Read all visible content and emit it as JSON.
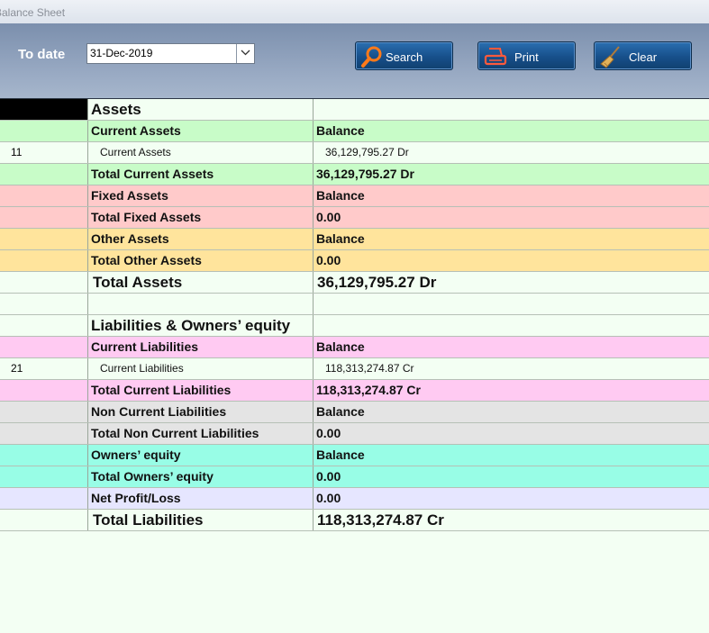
{
  "window": {
    "title": "Balance Sheet"
  },
  "toolbar": {
    "to_date_label": "To date",
    "date_value": "31-Dec-2019",
    "search_label": "Search",
    "print_label": "Print",
    "clear_label": "Clear"
  },
  "colors": {
    "green": "#c8fcc8",
    "red": "#ffcaca",
    "orange": "#ffe49c",
    "pink": "#ffcaf2",
    "gray": "#e4e4e4",
    "aqua": "#98fde6",
    "lavender": "#e6e6ff",
    "base": "#f3fff3"
  },
  "rows": [
    {
      "code": "",
      "name": "Assets",
      "value": ""
    },
    {
      "code": "",
      "name": "Current Assets",
      "value": "Balance"
    },
    {
      "code": "11",
      "name": "Current Assets",
      "value": "36,129,795.27 Dr"
    },
    {
      "code": "",
      "name": "Total Current Assets",
      "value": "36,129,795.27 Dr"
    },
    {
      "code": "",
      "name": "Fixed Assets",
      "value": "Balance"
    },
    {
      "code": "",
      "name": "Total Fixed Assets",
      "value": "0.00"
    },
    {
      "code": "",
      "name": "Other Assets",
      "value": "Balance"
    },
    {
      "code": "",
      "name": "Total Other Assets",
      "value": "0.00"
    },
    {
      "code": "",
      "name": "Total Assets",
      "value": "36,129,795.27 Dr"
    },
    {
      "code": "",
      "name": "",
      "value": ""
    },
    {
      "code": "",
      "name": "Liabilities & Owners’ equity",
      "value": ""
    },
    {
      "code": "",
      "name": "Current Liabilities",
      "value": "Balance"
    },
    {
      "code": "21",
      "name": "Current Liabilities",
      "value": "118,313,274.87 Cr"
    },
    {
      "code": "",
      "name": "Total Current Liabilities",
      "value": "118,313,274.87 Cr"
    },
    {
      "code": "",
      "name": "Non Current Liabilities",
      "value": "Balance"
    },
    {
      "code": "",
      "name": "Total Non Current Liabilities",
      "value": "0.00"
    },
    {
      "code": "",
      "name": "Owners’ equity",
      "value": "Balance"
    },
    {
      "code": "",
      "name": "Total Owners’ equity",
      "value": "0.00"
    },
    {
      "code": "",
      "name": "Net Profit/Loss",
      "value": "0.00"
    },
    {
      "code": "",
      "name": "Total Liabilities",
      "value": "118,313,274.87 Cr"
    }
  ]
}
